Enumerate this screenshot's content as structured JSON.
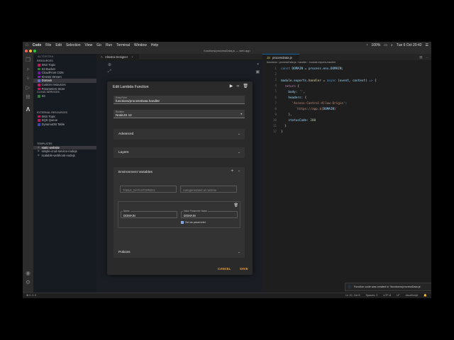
{
  "menubar": {
    "apple": "",
    "app": "Code",
    "items": [
      "File",
      "Edit",
      "Selection",
      "View",
      "Go",
      "Run",
      "Terminal",
      "Window",
      "Help"
    ],
    "battery": "100%",
    "datetime": "Tue 6 Oct  20:42"
  },
  "window": {
    "title": "functions/processData.js — web-app"
  },
  "sidebar": {
    "header": "ALTOSTRA",
    "resources_label": "RESOURCES",
    "resources": [
      {
        "label": "SNS Topic",
        "color": "#c2185b"
      },
      {
        "label": "S3 Bucket",
        "color": "#2e7d32"
      },
      {
        "label": "CloudFront CDN",
        "color": "#6a1b9a"
      },
      {
        "label": "Kinesis Stream",
        "color": "#7b1fa2"
      },
      {
        "label": "Domain",
        "color": "#5c6bc0"
      },
      {
        "label": "Custom resources",
        "color": "#c2185b"
      },
      {
        "label": "Parameters Store",
        "color": "#c2185b"
      }
    ],
    "cloud_label": "CLOUD SERVICES",
    "cloud": [
      {
        "label": "S3",
        "color": "#2e7d32"
      }
    ],
    "external_label": "EXTERNAL RESOURCES",
    "external": [
      {
        "label": "SNS Topic",
        "color": "#c2185b"
      },
      {
        "label": "SQS Queue",
        "color": "#c2185b"
      },
      {
        "label": "DynamoDB Table",
        "color": "#3949ab"
      }
    ],
    "templates_label": "TEMPLATES",
    "templates": [
      "static-website",
      "simple-crud-service-nodejs",
      "scalable-webhook-nodejs"
    ]
  },
  "designer": {
    "tab_label": "Altostra Designer"
  },
  "modal": {
    "title": "Edit Lambda Function",
    "entry_point_label": "Entry Point",
    "entry_point_value": "functions/processData.handler",
    "runtime_label": "Runtime",
    "runtime_value": "NodeJS 12",
    "advanced": "Advanced",
    "layers": "Layers",
    "env_title": "Environment Variables",
    "env1_name": "TABLE_DATASTORED1",
    "env1_value": "Autogenerated at runtime",
    "env2_name_label": "Name",
    "env2_name": "DOMAIN",
    "env2_value_label": "Value Parameter Name",
    "env2_value": "DOMAIN",
    "set_param": "Set as parameter",
    "policies": "Policies",
    "cancel": "CANCEL",
    "save": "SAVE"
  },
  "editor": {
    "tab": "processData.js",
    "breadcrumbs": "functions  ›  processData.js  ›  handler  ›  module.exports.handler",
    "line_numbers": [
      "1",
      "2",
      "3",
      "4",
      "5",
      "6",
      "7",
      "8",
      "9",
      "10",
      "11",
      "12"
    ]
  },
  "toast": {
    "message": "Function code was created in '/functions/processData.js'."
  },
  "statusbar": {
    "left": "⊗ 0  ⚠ 0",
    "items": [
      "Ln 10, Col 8",
      "Spaces: 2",
      "UTF-8",
      "LF",
      "JavaScript"
    ]
  }
}
